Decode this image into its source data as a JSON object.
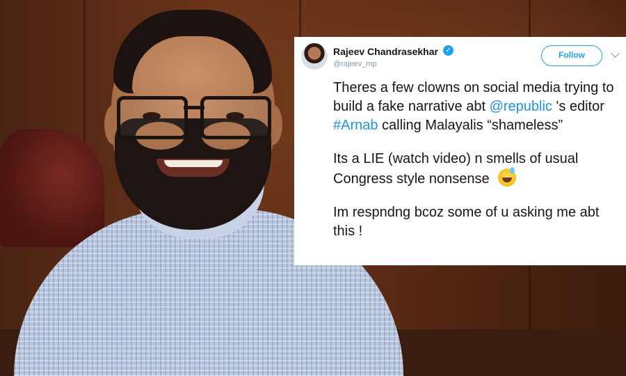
{
  "tweet": {
    "author_name": "Rajeev Chandrasekhar",
    "verified_mark": "✓",
    "handle": "@rajeev_mp",
    "follow_label": "Follow",
    "para1": {
      "t1": "Theres a few clowns on social media trying to build a fake narrative abt ",
      "mention": "@republic",
      "t2": " 's editor ",
      "hashtag": "#Arnab",
      "t3": " calling Malayalis “shameless”"
    },
    "para2": "Its a LIE (watch video) n smells of usual Congress style nonsense",
    "para3": "Im respndng bcoz some of u asking me abt this !",
    "emoji": "grinning-face-with-sweat-icon"
  },
  "colors": {
    "accent": "#1da1f2",
    "link": "#1b95e0",
    "text": "#14171a",
    "muted": "#8899a6"
  }
}
